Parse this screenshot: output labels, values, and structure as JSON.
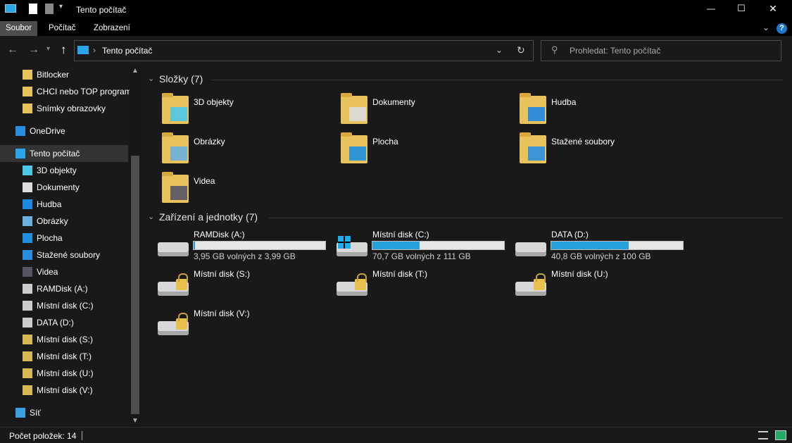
{
  "window": {
    "title": "Tento počítač",
    "minimize": "—",
    "maximize": "☐",
    "close": "✕"
  },
  "ribbon": {
    "tabs": [
      {
        "label": "Soubor"
      },
      {
        "label": "Počítač"
      },
      {
        "label": "Zobrazení"
      }
    ],
    "help": "?"
  },
  "nav": {
    "address": "Tento počítač",
    "search_placeholder": "Prohledat: Tento počítač"
  },
  "sidebar": {
    "items": [
      {
        "label": "Bitlocker",
        "icon": "folder-icon"
      },
      {
        "label": "CHCI nebo TOP program",
        "icon": "folder-icon"
      },
      {
        "label": "Snímky obrazovky",
        "icon": "folder-icon"
      },
      {
        "label": "OneDrive",
        "icon": "cloud-icon"
      },
      {
        "label": "Tento počítač",
        "icon": "computer-icon",
        "selected": true
      },
      {
        "label": "3D objekty",
        "icon": "cube-icon"
      },
      {
        "label": "Dokumenty",
        "icon": "document-icon"
      },
      {
        "label": "Hudba",
        "icon": "music-icon"
      },
      {
        "label": "Obrázky",
        "icon": "picture-icon"
      },
      {
        "label": "Plocha",
        "icon": "desktop-icon"
      },
      {
        "label": "Stažené soubory",
        "icon": "download-icon"
      },
      {
        "label": "Videa",
        "icon": "video-icon"
      },
      {
        "label": "RAMDisk (A:)",
        "icon": "drive-icon"
      },
      {
        "label": "Místní disk (C:)",
        "icon": "drive-icon"
      },
      {
        "label": "DATA (D:)",
        "icon": "drive-icon"
      },
      {
        "label": "Místní disk (S:)",
        "icon": "locked-drive-icon"
      },
      {
        "label": "Místní disk (T:)",
        "icon": "locked-drive-icon"
      },
      {
        "label": "Místní disk (U:)",
        "icon": "locked-drive-icon"
      },
      {
        "label": "Místní disk (V:)",
        "icon": "locked-drive-icon"
      },
      {
        "label": "Síť",
        "icon": "network-icon"
      }
    ]
  },
  "main": {
    "folders_header": "Složky (7)",
    "folders": [
      {
        "label": "3D objekty"
      },
      {
        "label": "Dokumenty"
      },
      {
        "label": "Hudba"
      },
      {
        "label": "Obrázky"
      },
      {
        "label": "Plocha"
      },
      {
        "label": "Stažené soubory"
      },
      {
        "label": "Videa"
      }
    ],
    "drives_header": "Zařízení a jednotky (7)",
    "drives": [
      {
        "label": "RAMDisk (A:)",
        "free": "3,95 GB volných z 3,99 GB",
        "used_fraction": 0.01
      },
      {
        "label": "Místní disk (C:)",
        "free": "70,7 GB volných z 111 GB",
        "used_fraction": 0.36
      },
      {
        "label": "DATA (D:)",
        "free": "40,8 GB volných z 100 GB",
        "used_fraction": 0.59
      },
      {
        "label": "Místní disk (S:)"
      },
      {
        "label": "Místní disk (T:)"
      },
      {
        "label": "Místní disk (U:)"
      },
      {
        "label": "Místní disk (V:)"
      }
    ]
  },
  "status": {
    "count": "Počet položek: 14"
  },
  "colors": {
    "accent": "#26a0da",
    "folder": "#e8c25a",
    "background": "#191919"
  }
}
